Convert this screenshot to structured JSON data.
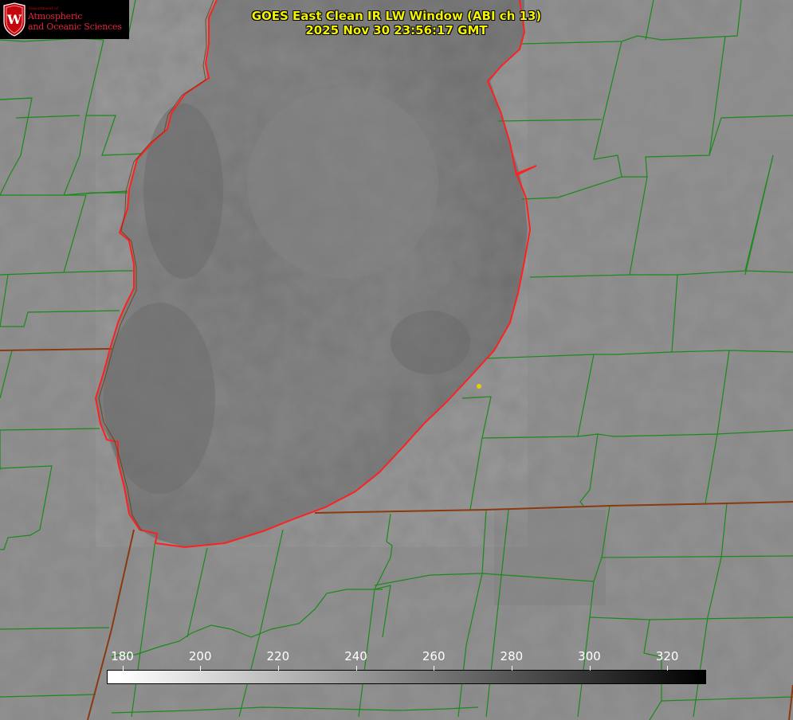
{
  "title": {
    "line1": "GOES East Clean IR LW Window (ABI ch 13)",
    "line2": "2025 Nov 30 23:56:17 GMT"
  },
  "logo": {
    "department": "Department of",
    "line1": "Atmospheric",
    "line2": "and Oceanic Sciences",
    "seal_letter": "W"
  },
  "colorbar": {
    "ticks": [
      {
        "value": "180"
      },
      {
        "value": "200"
      },
      {
        "value": "220"
      },
      {
        "value": "240"
      },
      {
        "value": "260"
      },
      {
        "value": "280"
      },
      {
        "value": "300"
      },
      {
        "value": "320"
      }
    ],
    "min": 176,
    "max": 330,
    "color_start": "#ffffff",
    "color_end": "#000000"
  },
  "colors": {
    "county_lines": "#1a8a1a",
    "state_lines": "#8b3a10",
    "lake_outline": "#ff2020",
    "station_marker": "#e6d000",
    "title_text": "#f4f400",
    "brand_red": "#c5050c"
  }
}
